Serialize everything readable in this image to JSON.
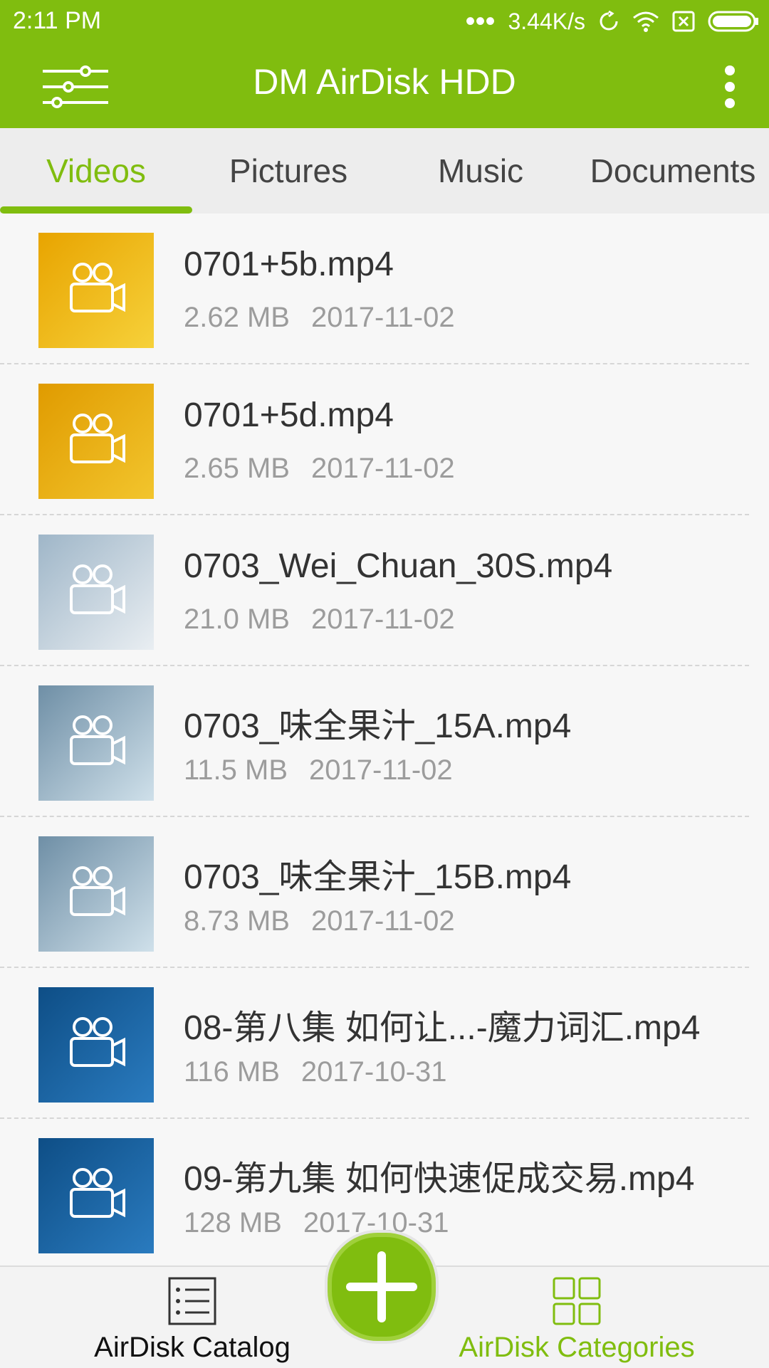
{
  "status_bar": {
    "time": "2:11 PM",
    "network_speed": "3.44K/s"
  },
  "toolbar": {
    "title": "DM AirDisk HDD"
  },
  "tabs": [
    {
      "label": "Videos",
      "active": true
    },
    {
      "label": "Pictures",
      "active": false
    },
    {
      "label": "Music",
      "active": false
    },
    {
      "label": "Documents",
      "active": false
    }
  ],
  "files": [
    {
      "name": "0701+5b.mp4",
      "size": "2.62 MB",
      "date": "2017-11-02",
      "thumb_colors": [
        "#e8a400",
        "#f6d13a"
      ]
    },
    {
      "name": "0701+5d.mp4",
      "size": "2.65 MB",
      "date": "2017-11-02",
      "thumb_colors": [
        "#e09b00",
        "#f2c52d"
      ]
    },
    {
      "name": "0703_Wei_Chuan_30S.mp4",
      "size": "21.0 MB",
      "date": "2017-11-02",
      "thumb_colors": [
        "#9fb6c8",
        "#e9eef2"
      ]
    },
    {
      "name": "0703_味全果汁_15A.mp4",
      "size": "11.5 MB",
      "date": "2017-11-02",
      "thumb_colors": [
        "#6f8fa6",
        "#cfe0ea"
      ]
    },
    {
      "name": "0703_味全果汁_15B.mp4",
      "size": "8.73 MB",
      "date": "2017-11-02",
      "thumb_colors": [
        "#6f8fa6",
        "#cfe0ea"
      ]
    },
    {
      "name": "08-第八集 如何让...-魔力词汇.mp4",
      "size": "116 MB",
      "date": "2017-10-31",
      "thumb_colors": [
        "#0e4e86",
        "#2a7bbf"
      ]
    },
    {
      "name": "09-第九集 如何快速促成交易.mp4",
      "size": "128 MB",
      "date": "2017-10-31",
      "thumb_colors": [
        "#0e4e86",
        "#2a7bbf"
      ]
    }
  ],
  "bottom_nav": {
    "catalog_label": "AirDisk Catalog",
    "categories_label": "AirDisk Categories"
  },
  "colors": {
    "accent": "#80bd0f"
  }
}
